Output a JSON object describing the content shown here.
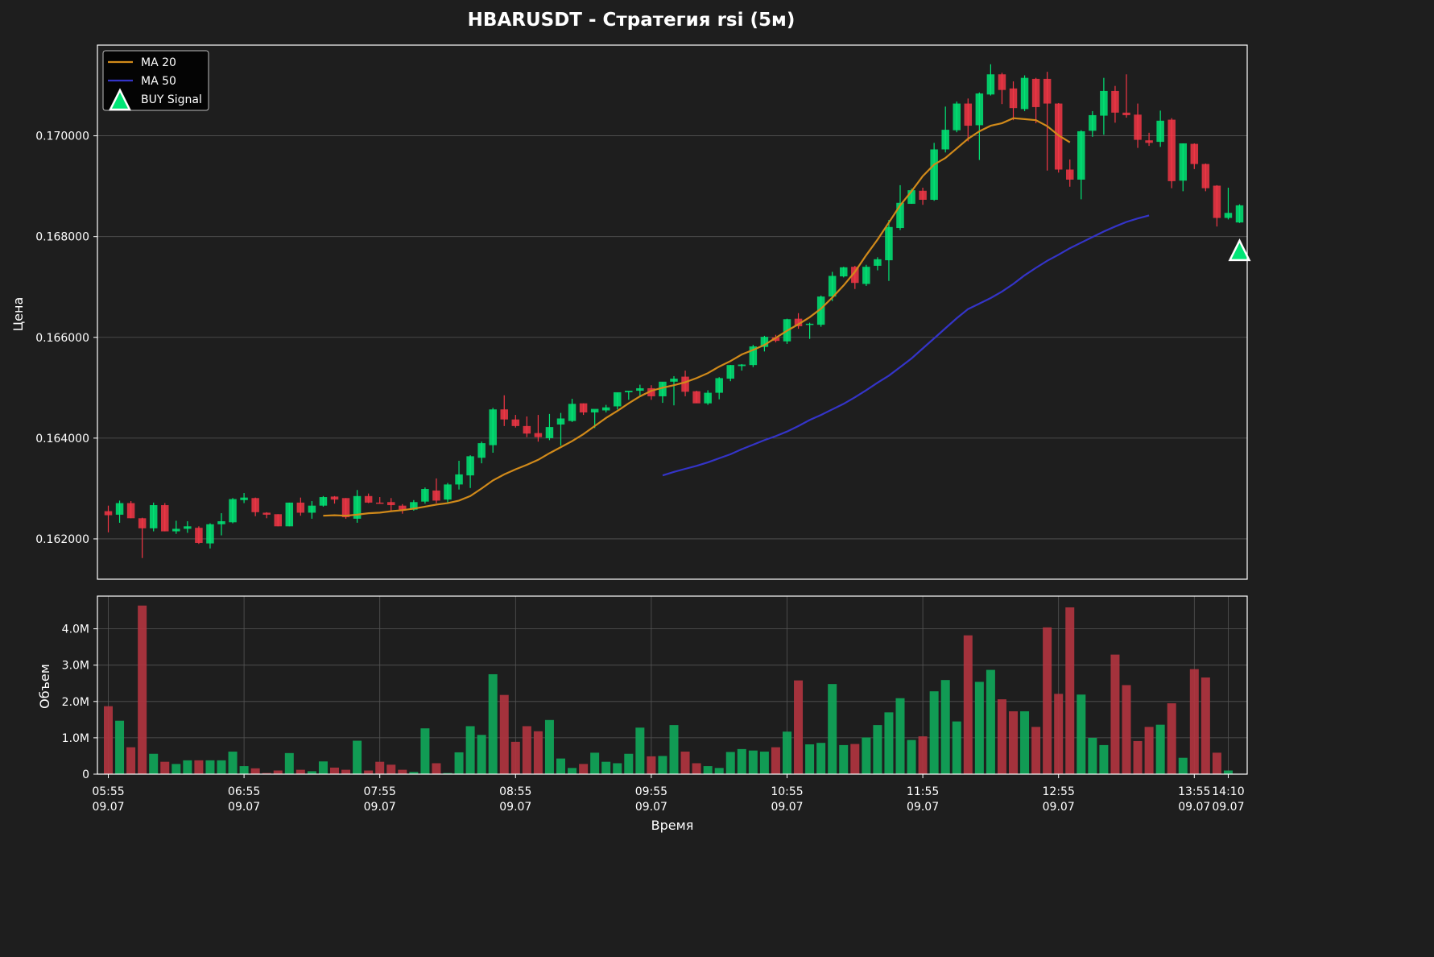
{
  "title": "HBARUSDT - Стратегия rsi (5м)",
  "colors": {
    "background": "#1e1e1e",
    "up": "#00e676",
    "down": "#f23645",
    "ma20": "#d18a1a",
    "ma50": "#3434c8",
    "grid": "#555555",
    "text": "#ffffff",
    "vol_up": "#10a85a",
    "vol_down": "#b3343f"
  },
  "chart_data": [
    {
      "type": "candlestick",
      "ylabel": "Цена",
      "ylim": [
        0.1612,
        0.1718
      ],
      "yticks": [
        "0.162000",
        "0.164000",
        "0.166000",
        "0.168000",
        "0.170000"
      ],
      "ytick_values": [
        0.162,
        0.164,
        0.166,
        0.168,
        0.17
      ],
      "interval_minutes": 5,
      "first_time": "05:55",
      "legend_position": "top-left",
      "legend": [
        "MA 20",
        "MA 50",
        "BUY Signal"
      ],
      "candles": [
        [
          0.16255,
          0.16266,
          0.16213,
          0.16247
        ],
        [
          0.16248,
          0.16276,
          0.16232,
          0.16271
        ],
        [
          0.16271,
          0.16275,
          0.16241,
          0.16241
        ],
        [
          0.16241,
          0.16242,
          0.16162,
          0.16221
        ],
        [
          0.16221,
          0.16272,
          0.16215,
          0.16267
        ],
        [
          0.16267,
          0.16271,
          0.16215,
          0.16215
        ],
        [
          0.16215,
          0.16236,
          0.1621,
          0.1622
        ],
        [
          0.1622,
          0.16235,
          0.16212,
          0.16225
        ],
        [
          0.16222,
          0.16225,
          0.1619,
          0.16192
        ],
        [
          0.16191,
          0.16231,
          0.16181,
          0.16229
        ],
        [
          0.16229,
          0.16251,
          0.16207,
          0.16235
        ],
        [
          0.16233,
          0.16281,
          0.16231,
          0.16279
        ],
        [
          0.16277,
          0.16291,
          0.16271,
          0.16282
        ],
        [
          0.16281,
          0.16282,
          0.16245,
          0.16253
        ],
        [
          0.16252,
          0.16253,
          0.16241,
          0.16248
        ],
        [
          0.16249,
          0.16249,
          0.16225,
          0.16225
        ],
        [
          0.16225,
          0.16272,
          0.16225,
          0.16272
        ],
        [
          0.16272,
          0.16282,
          0.16246,
          0.16252
        ],
        [
          0.16252,
          0.16275,
          0.1624,
          0.16266
        ],
        [
          0.16266,
          0.16285,
          0.16264,
          0.16283
        ],
        [
          0.16284,
          0.16285,
          0.1627,
          0.16278
        ],
        [
          0.16281,
          0.16281,
          0.1624,
          0.16243
        ],
        [
          0.1624,
          0.16297,
          0.16232,
          0.16285
        ],
        [
          0.16285,
          0.1629,
          0.16271,
          0.16272
        ],
        [
          0.16272,
          0.16283,
          0.1627,
          0.16271
        ],
        [
          0.16273,
          0.16281,
          0.16256,
          0.16267
        ],
        [
          0.16266,
          0.16269,
          0.1625,
          0.16258
        ],
        [
          0.16258,
          0.16277,
          0.16256,
          0.16273
        ],
        [
          0.16274,
          0.16302,
          0.1627,
          0.16299
        ],
        [
          0.16296,
          0.1632,
          0.16271,
          0.16276
        ],
        [
          0.16278,
          0.16311,
          0.16272,
          0.16308
        ],
        [
          0.16308,
          0.16355,
          0.16298,
          0.16328
        ],
        [
          0.16326,
          0.16366,
          0.16301,
          0.16364
        ],
        [
          0.16361,
          0.16393,
          0.1635,
          0.1639
        ],
        [
          0.16386,
          0.1646,
          0.16371,
          0.16457
        ],
        [
          0.16457,
          0.16485,
          0.16424,
          0.16437
        ],
        [
          0.16437,
          0.16446,
          0.16421,
          0.16424
        ],
        [
          0.16424,
          0.16443,
          0.16402,
          0.16409
        ],
        [
          0.1641,
          0.16446,
          0.16393,
          0.16402
        ],
        [
          0.164,
          0.16448,
          0.16396,
          0.16422
        ],
        [
          0.16427,
          0.1645,
          0.16385,
          0.16439
        ],
        [
          0.16434,
          0.16478,
          0.16432,
          0.16468
        ],
        [
          0.16469,
          0.16469,
          0.16446,
          0.16451
        ],
        [
          0.16451,
          0.16455,
          0.1642,
          0.16458
        ],
        [
          0.16455,
          0.16466,
          0.16451,
          0.16461
        ],
        [
          0.16463,
          0.1649,
          0.16457,
          0.16491
        ],
        [
          0.16491,
          0.16493,
          0.16476,
          0.16494
        ],
        [
          0.16494,
          0.16506,
          0.16484,
          0.16499
        ],
        [
          0.16499,
          0.16505,
          0.16476,
          0.16483
        ],
        [
          0.16483,
          0.16511,
          0.1647,
          0.16512
        ],
        [
          0.16512,
          0.16523,
          0.16465,
          0.16518
        ],
        [
          0.16522,
          0.16534,
          0.16483,
          0.16492
        ],
        [
          0.16493,
          0.16494,
          0.1647,
          0.16469
        ],
        [
          0.16469,
          0.16495,
          0.16466,
          0.1649
        ],
        [
          0.1649,
          0.16521,
          0.16477,
          0.16519
        ],
        [
          0.16518,
          0.16545,
          0.16513,
          0.16545
        ],
        [
          0.16543,
          0.16547,
          0.16534,
          0.16546
        ],
        [
          0.16545,
          0.16585,
          0.16541,
          0.16582
        ],
        [
          0.16581,
          0.16603,
          0.16572,
          0.16601
        ],
        [
          0.166,
          0.16605,
          0.1659,
          0.16593
        ],
        [
          0.16592,
          0.16637,
          0.16587,
          0.16636
        ],
        [
          0.16637,
          0.16648,
          0.16617,
          0.16622
        ],
        [
          0.16625,
          0.16629,
          0.16597,
          0.16627
        ],
        [
          0.16625,
          0.16683,
          0.16621,
          0.16681
        ],
        [
          0.16681,
          0.1673,
          0.16672,
          0.16722
        ],
        [
          0.16721,
          0.1674,
          0.16719,
          0.16739
        ],
        [
          0.1674,
          0.16742,
          0.16696,
          0.16708
        ],
        [
          0.16706,
          0.16744,
          0.16702,
          0.1674
        ],
        [
          0.16742,
          0.16759,
          0.16733,
          0.16755
        ],
        [
          0.16753,
          0.16833,
          0.16712,
          0.16819
        ],
        [
          0.16817,
          0.16902,
          0.16813,
          0.16867
        ],
        [
          0.16865,
          0.16895,
          0.16865,
          0.16892
        ],
        [
          0.16891,
          0.16897,
          0.16863,
          0.16873
        ],
        [
          0.16873,
          0.16986,
          0.16871,
          0.16973
        ],
        [
          0.16973,
          0.17058,
          0.16967,
          0.17012
        ],
        [
          0.17011,
          0.17068,
          0.17007,
          0.17064
        ],
        [
          0.17064,
          0.17074,
          0.16989,
          0.1702
        ],
        [
          0.17021,
          0.17086,
          0.16952,
          0.17084
        ],
        [
          0.17082,
          0.17142,
          0.1708,
          0.17122
        ],
        [
          0.17122,
          0.17125,
          0.17063,
          0.17091
        ],
        [
          0.17094,
          0.17108,
          0.17031,
          0.17055
        ],
        [
          0.17053,
          0.1712,
          0.17049,
          0.17115
        ],
        [
          0.17113,
          0.17115,
          0.17025,
          0.17057
        ],
        [
          0.17113,
          0.17127,
          0.16931,
          0.17064
        ],
        [
          0.17064,
          0.17065,
          0.16927,
          0.16933
        ],
        [
          0.16933,
          0.16953,
          0.16899,
          0.16913
        ],
        [
          0.16913,
          0.17011,
          0.16874,
          0.17009
        ],
        [
          0.1701,
          0.17049,
          0.16998,
          0.17041
        ],
        [
          0.1704,
          0.17115,
          0.17002,
          0.17089
        ],
        [
          0.17089,
          0.17099,
          0.17026,
          0.17046
        ],
        [
          0.17046,
          0.17122,
          0.17036,
          0.17041
        ],
        [
          0.17042,
          0.17064,
          0.16976,
          0.16992
        ],
        [
          0.16991,
          0.17006,
          0.1698,
          0.16986
        ],
        [
          0.16988,
          0.1705,
          0.16978,
          0.1703
        ],
        [
          0.17032,
          0.17035,
          0.16896,
          0.1691
        ],
        [
          0.16911,
          0.16985,
          0.1689,
          0.16985
        ],
        [
          0.16984,
          0.16985,
          0.16934,
          0.16944
        ],
        [
          0.16944,
          0.16945,
          0.1689,
          0.16896
        ],
        [
          0.16901,
          0.16902,
          0.1682,
          0.16837
        ],
        [
          0.16837,
          0.16897,
          0.16834,
          0.16847
        ],
        [
          0.16828,
          0.16864,
          0.16827,
          0.16862
        ]
      ],
      "series": [
        {
          "name": "MA 20",
          "start_index": 19,
          "values": [
            0.16246,
            0.16247,
            0.16246,
            0.16248,
            0.16251,
            0.16252,
            0.16255,
            0.16257,
            0.1626,
            0.16264,
            0.16268,
            0.16271,
            0.16276,
            0.16285,
            0.163,
            0.16316,
            0.16328,
            0.16338,
            0.16347,
            0.16357,
            0.1637,
            0.16382,
            0.16394,
            0.16408,
            0.16424,
            0.1644,
            0.16454,
            0.16469,
            0.16483,
            0.16494,
            0.165,
            0.16505,
            0.16511,
            0.16519,
            0.16529,
            0.16542,
            0.16553,
            0.16566,
            0.16575,
            0.16585,
            0.16599,
            0.16613,
            0.16626,
            0.1664,
            0.16657,
            0.16679,
            0.16703,
            0.1673,
            0.16763,
            0.16794,
            0.16828,
            0.16862,
            0.1689,
            0.1692,
            0.16943,
            0.16956,
            0.16975,
            0.16994,
            0.17009,
            0.1702,
            0.17025,
            0.17035,
            0.17033,
            0.17031,
            0.17019,
            0.17001,
            0.16987
          ]
        },
        {
          "name": "MA 50",
          "start_index": 49,
          "values": [
            0.16326,
            0.16333,
            0.16339,
            0.16345,
            0.16352,
            0.1636,
            0.16368,
            0.16378,
            0.16387,
            0.16396,
            0.16404,
            0.16413,
            0.16424,
            0.16436,
            0.16446,
            0.16457,
            0.16468,
            0.16481,
            0.16495,
            0.1651,
            0.16524,
            0.16541,
            0.16558,
            0.16578,
            0.16598,
            0.16618,
            0.16638,
            0.16656,
            0.16667,
            0.16678,
            0.16691,
            0.16706,
            0.16723,
            0.16738,
            0.16752,
            0.16764,
            0.16777,
            0.16788,
            0.16799,
            0.1681,
            0.1682,
            0.16829,
            0.16836,
            0.16842
          ]
        }
      ],
      "buy_signals": [
        {
          "index": 100,
          "price": 0.16771
        }
      ]
    },
    {
      "type": "bar",
      "ylabel": "Объем",
      "xlabel": "Время",
      "ylim": [
        0,
        4900000
      ],
      "yticks": [
        "0",
        "1.0M",
        "2.0M",
        "3.0M",
        "4.0M"
      ],
      "ytick_values": [
        0,
        1000000,
        2000000,
        3000000,
        4000000
      ],
      "xticks": [
        {
          "index": 0,
          "time": "05:55",
          "date": "09.07"
        },
        {
          "index": 12,
          "time": "06:55",
          "date": "09.07"
        },
        {
          "index": 24,
          "time": "07:55",
          "date": "09.07"
        },
        {
          "index": 36,
          "time": "08:55",
          "date": "09.07"
        },
        {
          "index": 48,
          "time": "09:55",
          "date": "09.07"
        },
        {
          "index": 60,
          "time": "10:55",
          "date": "09.07"
        },
        {
          "index": 72,
          "time": "11:55",
          "date": "09.07"
        },
        {
          "index": 84,
          "time": "12:55",
          "date": "09.07"
        },
        {
          "index": 96,
          "time": "13:55",
          "date": "09.07"
        },
        {
          "index": 99,
          "time": "14:10",
          "date": "09.07"
        }
      ],
      "volumes": [
        1870000,
        1470000,
        740000,
        4640000,
        560000,
        340000,
        280000,
        380000,
        380000,
        380000,
        380000,
        620000,
        220000,
        160000,
        30000,
        100000,
        580000,
        120000,
        80000,
        350000,
        180000,
        120000,
        920000,
        100000,
        340000,
        260000,
        120000,
        60000,
        1260000,
        300000,
        30000,
        600000,
        1320000,
        1080000,
        2750000,
        2180000,
        890000,
        1320000,
        1180000,
        1490000,
        430000,
        170000,
        280000,
        590000,
        340000,
        300000,
        560000,
        1280000,
        490000,
        500000,
        1350000,
        620000,
        300000,
        220000,
        170000,
        610000,
        690000,
        650000,
        620000,
        740000,
        1170000,
        2580000,
        820000,
        860000,
        2480000,
        800000,
        830000,
        1010000,
        1350000,
        1700000,
        2090000,
        940000,
        1040000,
        2280000,
        2590000,
        1450000,
        3820000,
        2540000,
        2870000,
        2060000,
        1730000,
        1730000,
        1300000,
        4040000,
        2210000,
        4590000,
        2190000,
        1000000,
        800000,
        3290000,
        2450000,
        910000,
        1300000,
        1360000,
        1950000,
        450000,
        2890000,
        2660000,
        590000,
        100000
      ]
    }
  ]
}
